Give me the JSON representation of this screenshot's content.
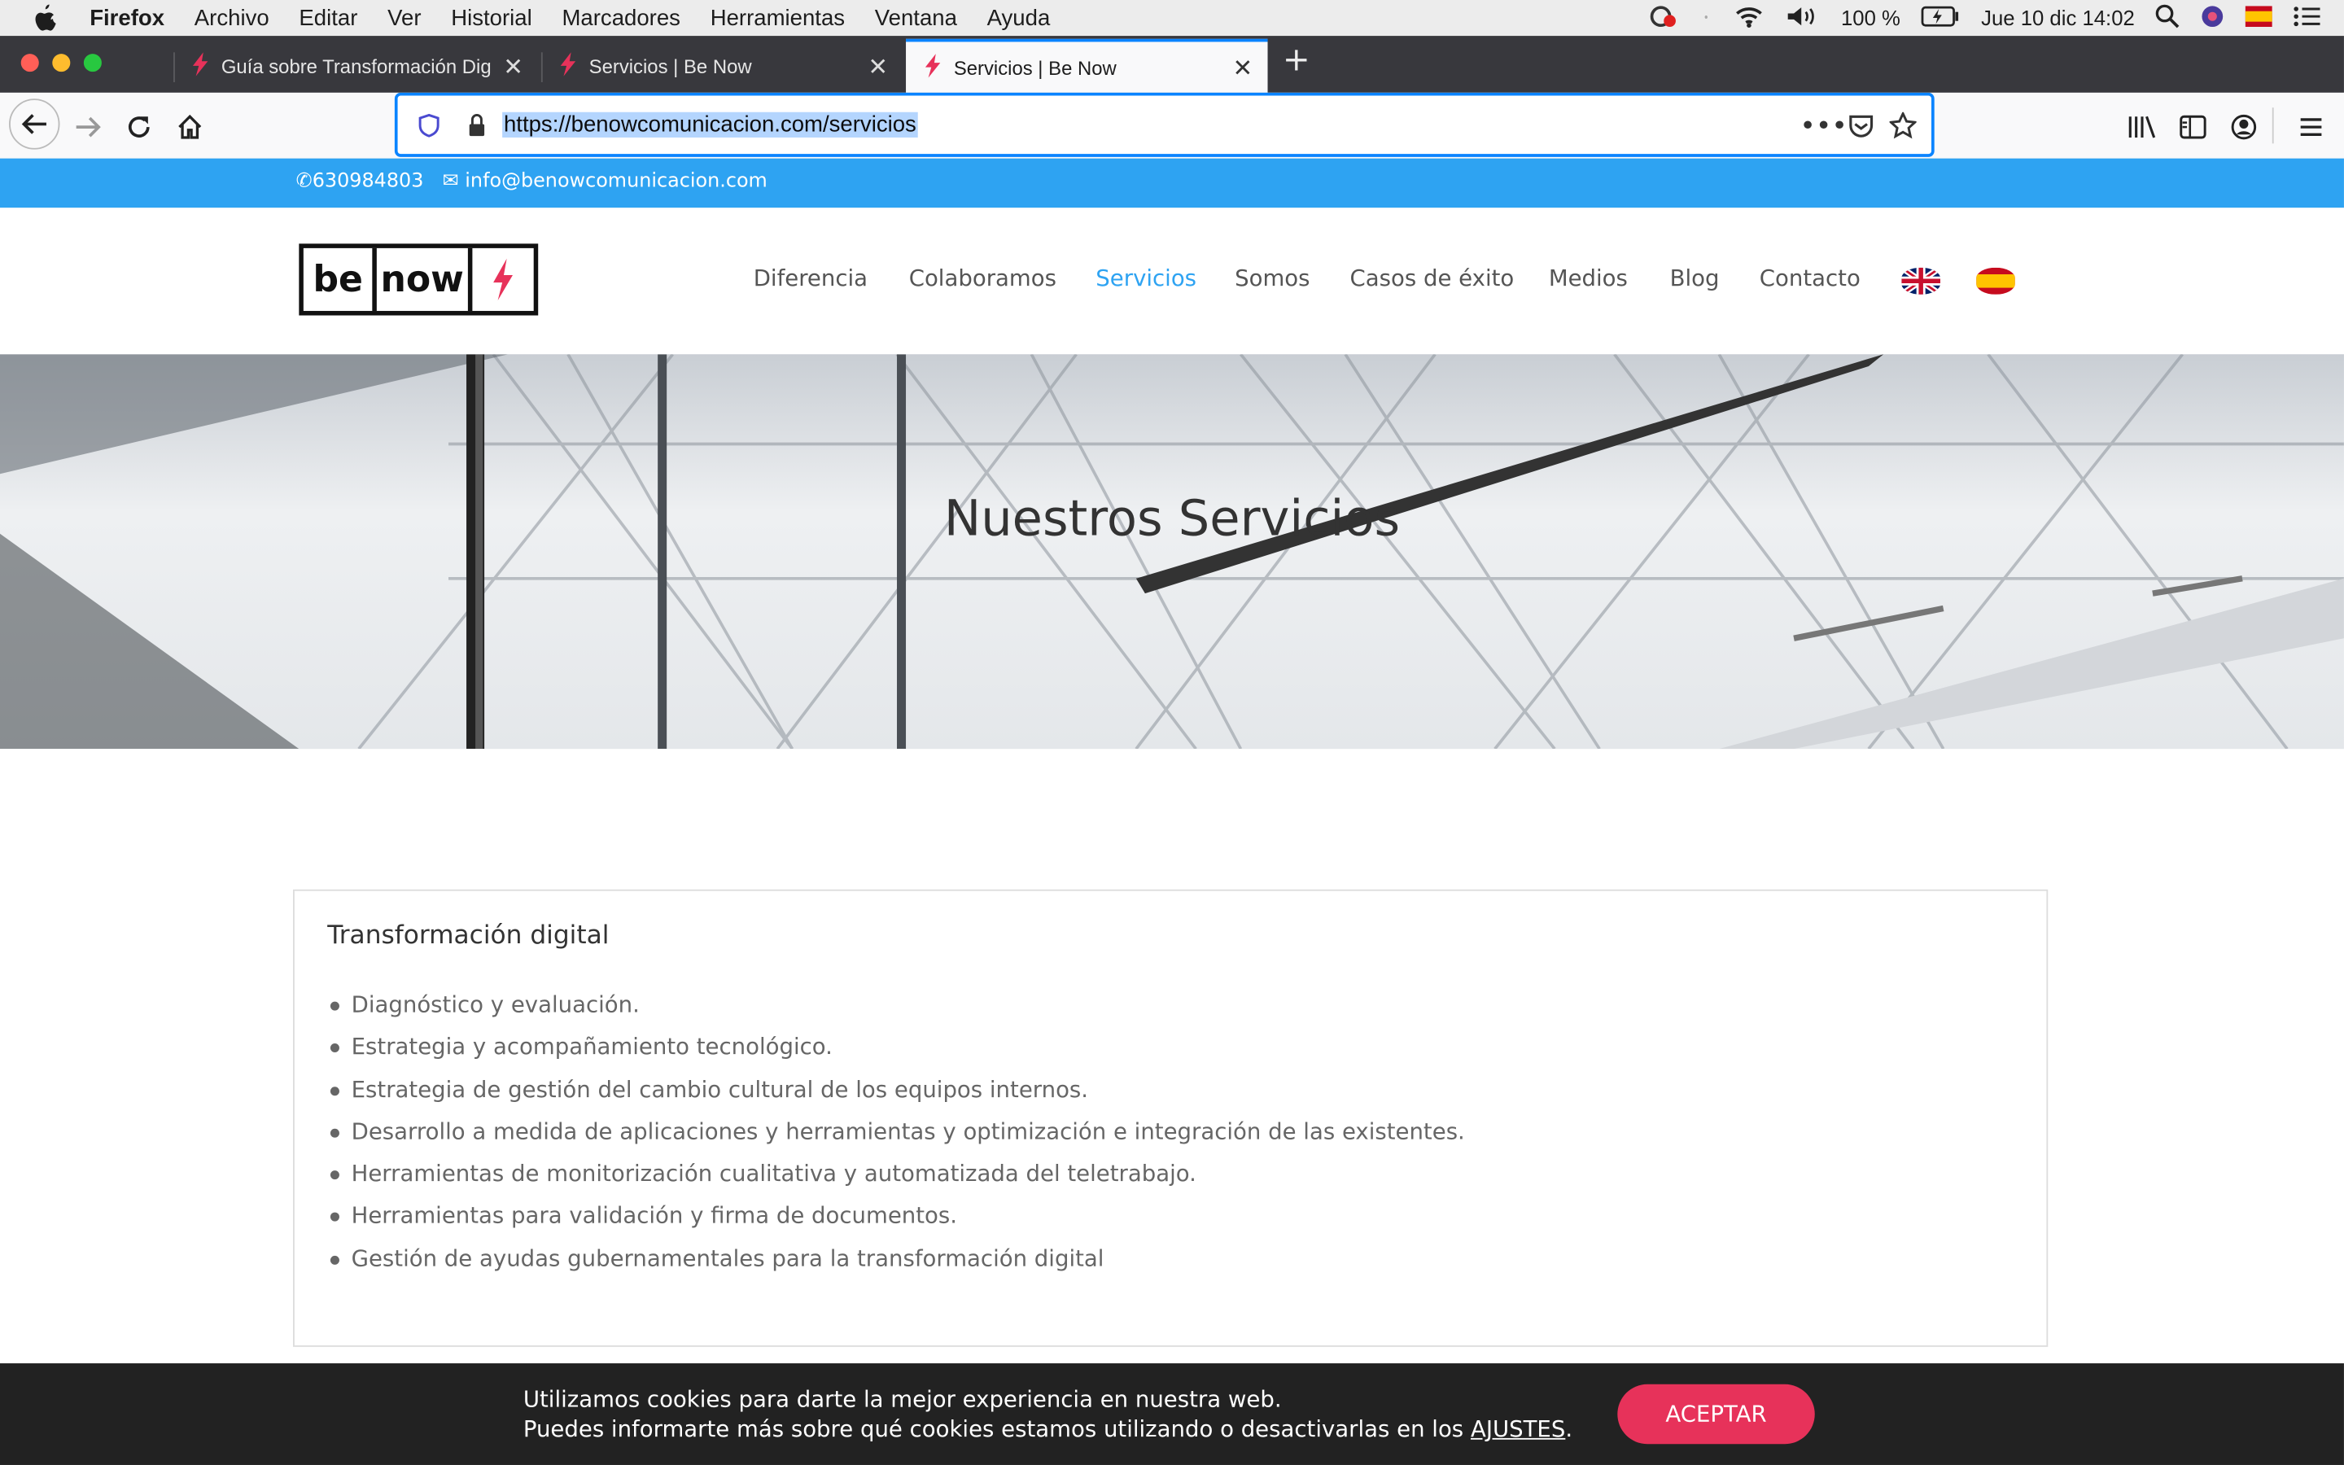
{
  "menubar": {
    "items": [
      "Firefox",
      "Archivo",
      "Editar",
      "Ver",
      "Historial",
      "Marcadores",
      "Herramientas",
      "Ventana",
      "Ayuda"
    ],
    "battery": "100 %",
    "clock": "Jue 10 dic  14:02"
  },
  "tabs": [
    {
      "title": "Guía sobre Transformación Digi",
      "active": false
    },
    {
      "title": "Servicios | Be Now",
      "active": false
    },
    {
      "title": "Servicios | Be Now",
      "active": true
    }
  ],
  "urlbar": {
    "url": "https://benowcomunicacion.com/servicios"
  },
  "site": {
    "topbar": {
      "phone": "630984803",
      "email": "info@benowcomunicacion.com"
    },
    "logo": {
      "part1": "be",
      "part2": "now"
    },
    "nav": [
      "Diferencia",
      "Colaboramos",
      "Servicios",
      "Somos",
      "Casos de éxito",
      "Medios",
      "Blog",
      "Contacto"
    ],
    "nav_active": "Servicios",
    "hero_title": "Nuestros Servicios",
    "card": {
      "title": "Transformación digital",
      "items": [
        "Diagnóstico y evaluación.",
        "Estrategia y acompañamiento tecnológico.",
        "Estrategia de gestión del cambio cultural de los equipos internos.",
        "Desarrollo a medida de aplicaciones y herramientas y optimización e integración de las existentes.",
        "Herramientas de monitorización cualitativa y automatizada del teletrabajo.",
        "Herramientas para validación y firma de documentos.",
        "Gestión de ayudas gubernamentales para la transformación digital"
      ]
    },
    "cookie": {
      "line1": "Utilizamos cookies para darte la mejor experiencia en nuestra web.",
      "line2": "Puedes informarte más sobre qué cookies estamos utilizando o desactivarlas en los",
      "link": "AJUSTES",
      "suffix": ".",
      "accept": "ACEPTAR"
    }
  },
  "colors": {
    "accent": "#2ea3f2",
    "cookie_button": "#e7325a",
    "logo_bolt": "#e7325a"
  }
}
